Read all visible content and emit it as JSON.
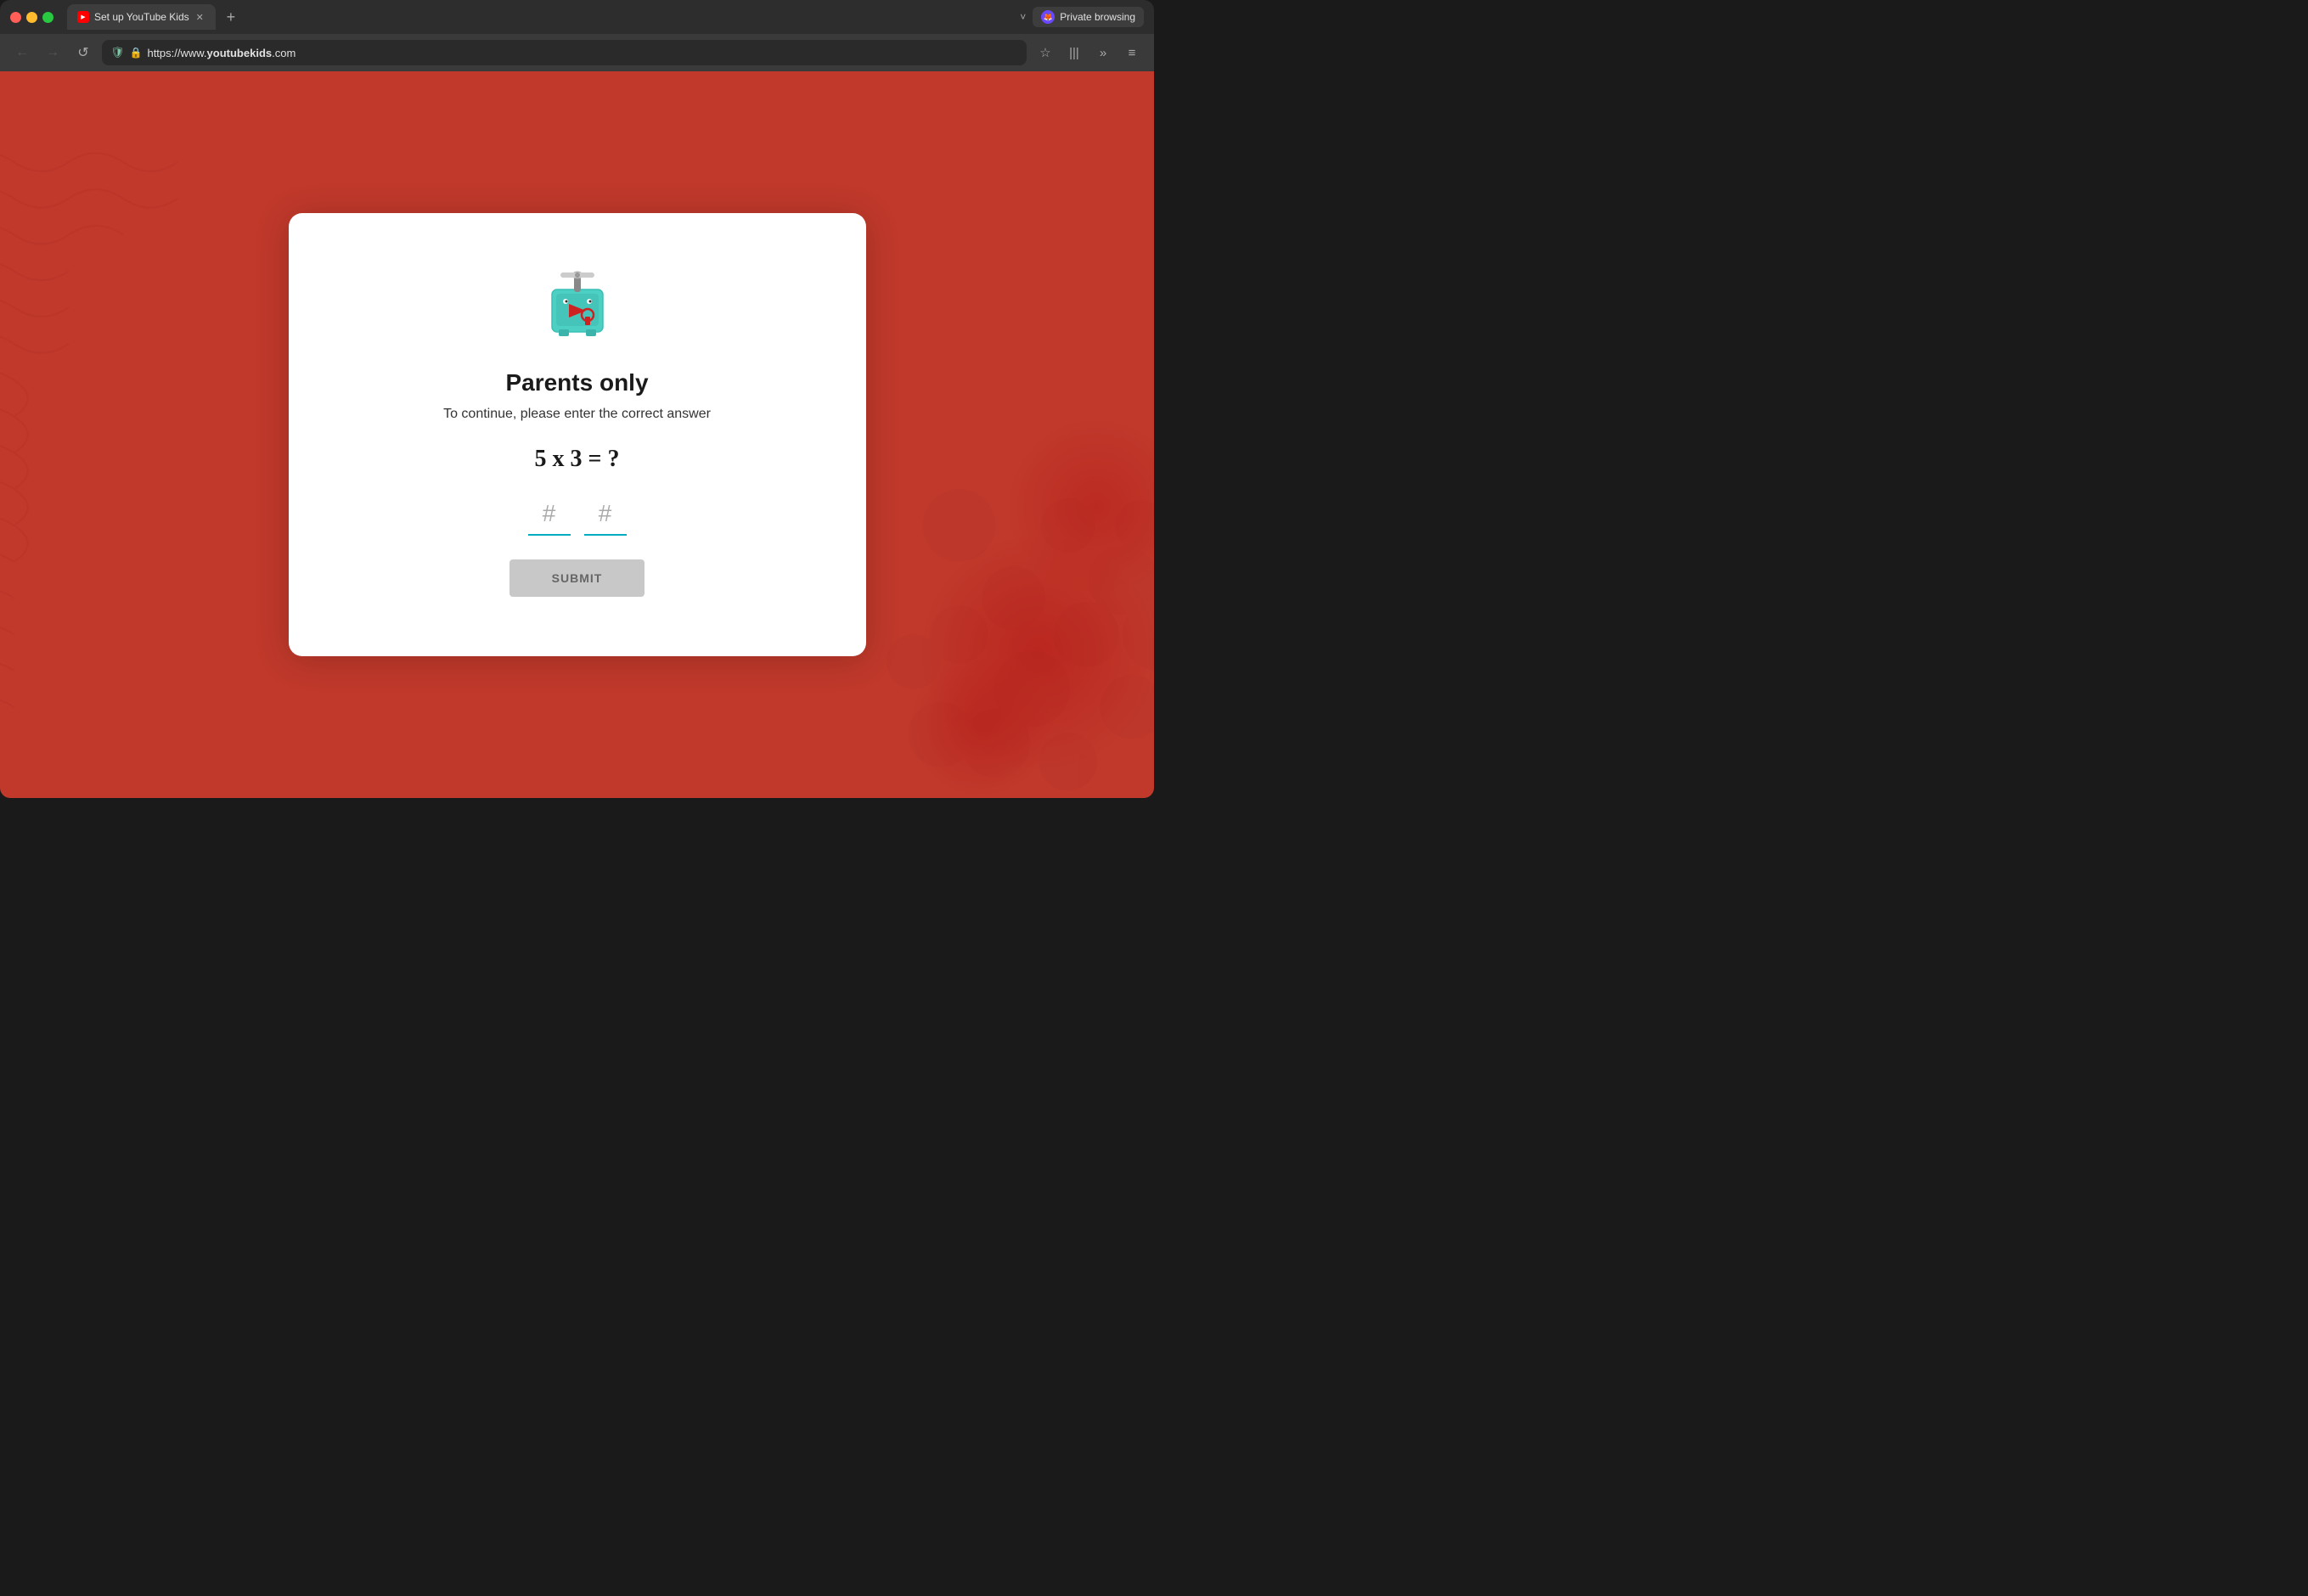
{
  "browser": {
    "tab": {
      "title": "Set up YouTube Kids",
      "favicon_label": "youtube-kids-favicon"
    },
    "new_tab_label": "+",
    "dropdown_label": "˅",
    "private_browsing": {
      "label": "Private browsing",
      "icon_label": "firefox-private-icon"
    },
    "nav": {
      "back_label": "←",
      "forward_label": "→",
      "reload_label": "↺",
      "url_scheme": "https://www.",
      "url_domain": "youtubekids",
      "url_tld": ".com",
      "bookmark_label": "☆",
      "history_label": "|||",
      "more_label": "»",
      "menu_label": "≡"
    }
  },
  "page": {
    "background_color": "#c0392b",
    "card": {
      "heading": "Parents only",
      "subtitle": "To continue, please enter the correct answer",
      "math_question": "5 x 3 = ?",
      "input1_placeholder": "#",
      "input2_placeholder": "#",
      "submit_label": "SUBMIT"
    }
  }
}
